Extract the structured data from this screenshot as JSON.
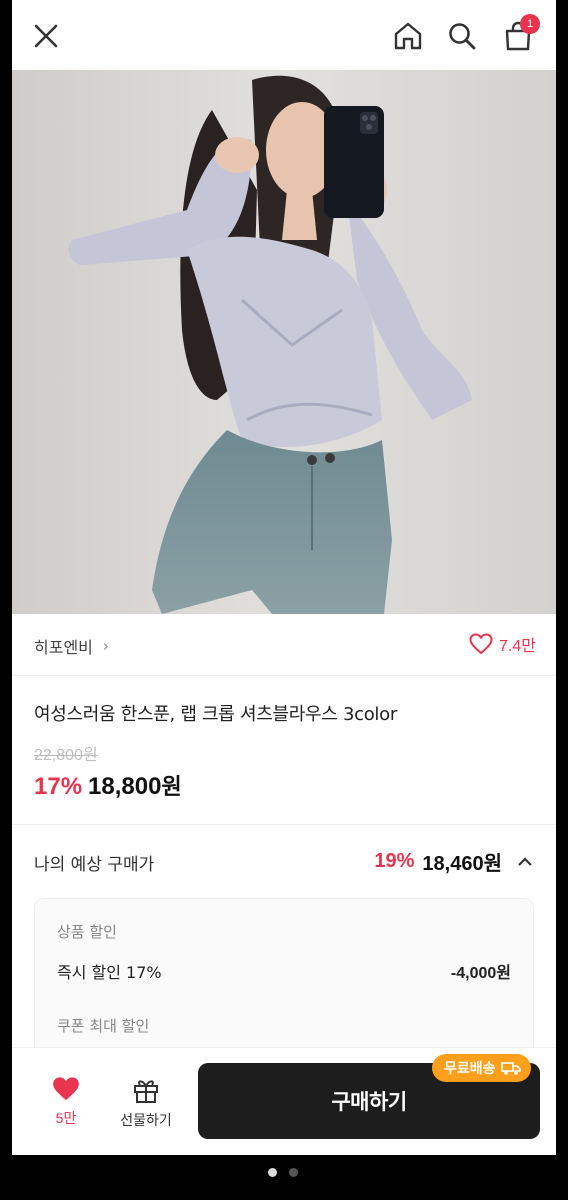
{
  "header": {
    "close_icon": "close-icon",
    "home_icon": "home-icon",
    "search_icon": "search-icon",
    "cart_icon": "shopping-bag-icon",
    "cart_badge": "1"
  },
  "gallery": {
    "page_count": 2,
    "current_page": 1,
    "expand_icon": "expand-icon"
  },
  "brand": {
    "name": "히포엔비",
    "chevron": "›",
    "like_count": "7.4만"
  },
  "product": {
    "title": "여성스러움 한스푼, 랩 크롭 셔츠블라우스 3color",
    "original_price": "22,800원",
    "discount_percent": "17%",
    "price": "18,800",
    "currency": "원"
  },
  "expected_price": {
    "label": "나의 예상 구매가",
    "discount_percent": "19%",
    "price": "18,460원"
  },
  "discount_details": {
    "product_discount_label": "상품 할인",
    "instant_discount_label": "즉시 할인 17%",
    "instant_discount_amount": "-4,000원",
    "coupon_label": "쿠폰 최대 할인"
  },
  "bottom_bar": {
    "wishlist_count": "5만",
    "gift_label": "선물하기",
    "buy_label": "구매하기",
    "free_shipping_label": "무료배송"
  },
  "colors": {
    "accent": "#e8344e",
    "buy_button": "#1d1d1d",
    "shipping_badge": "#ff9f1c"
  }
}
